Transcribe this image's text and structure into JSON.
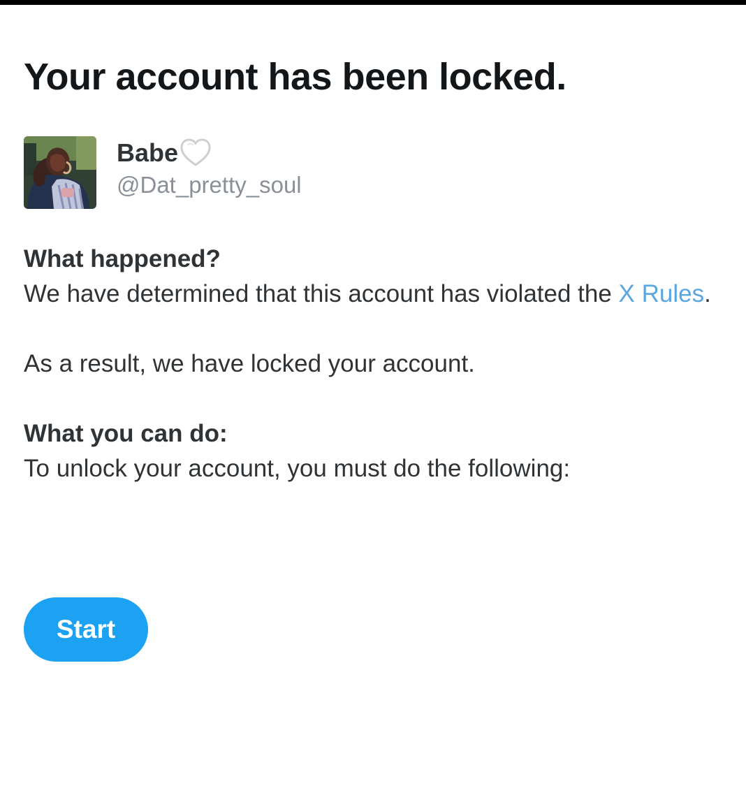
{
  "page": {
    "title": "Your account has been locked."
  },
  "account": {
    "display_name": "Babe",
    "handle": "@Dat_pretty_soul",
    "heart_icon": "white-heart-icon"
  },
  "what_happened": {
    "heading": "What happened?",
    "text_before_link": "We have determined that this account has violated the ",
    "link_text": "X Rules",
    "text_after_link": ".",
    "result_text": "As a result, we have locked your account."
  },
  "what_you_can_do": {
    "heading": "What you can do:",
    "text": "To unlock your account, you must do the following:"
  },
  "actions": {
    "start_label": "Start"
  },
  "colors": {
    "accent": "#1da1f2",
    "link": "#5aa6e0",
    "text": "#2f3336",
    "muted": "#8a9097"
  }
}
